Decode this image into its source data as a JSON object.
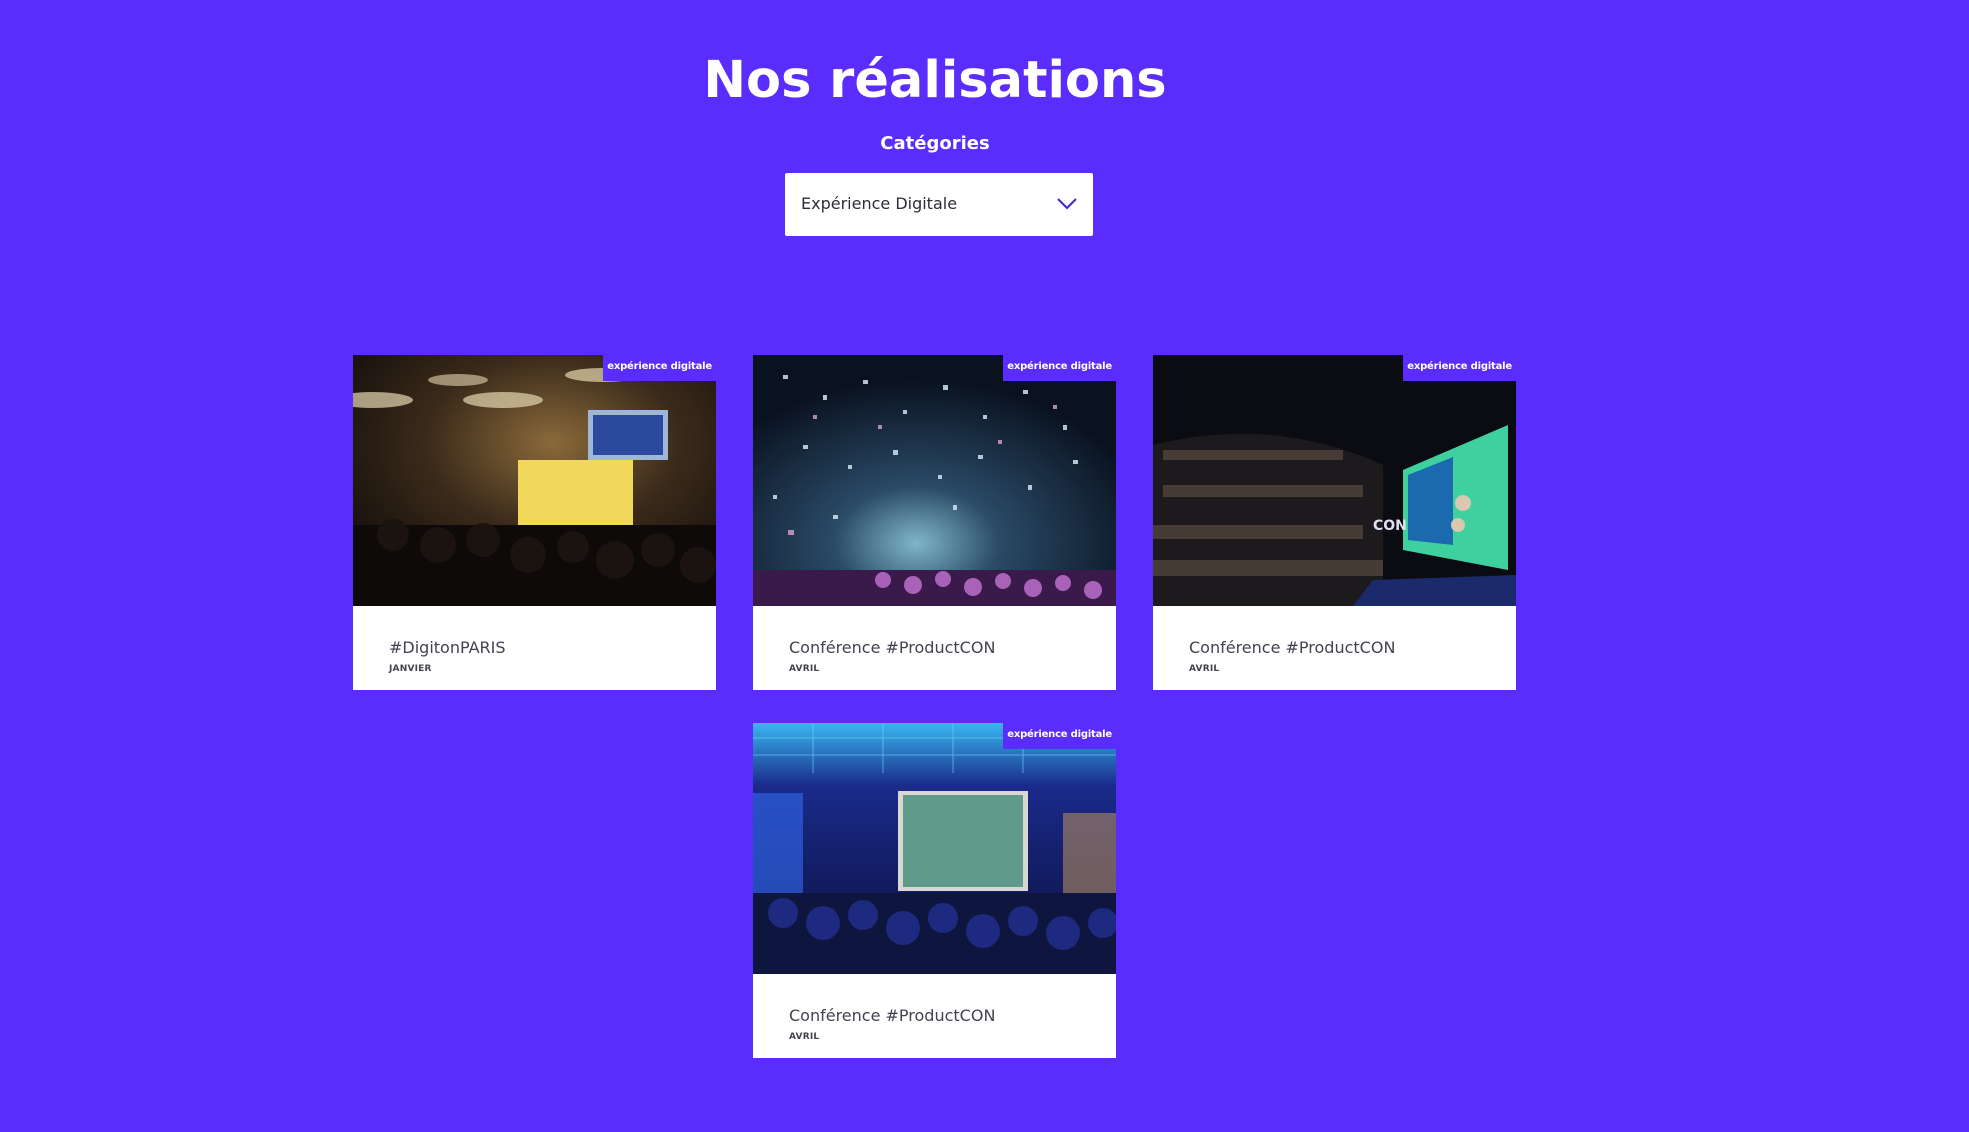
{
  "header": {
    "title": "Nos réalisations"
  },
  "filter": {
    "label": "Catégories",
    "selected": "Expérience Digitale"
  },
  "colors": {
    "background": "#5a2dfc",
    "card": "#ffffff",
    "text_dark": "#43434f"
  },
  "cards": [
    {
      "badge": "expérience digitale",
      "title": "#DigitonPARIS",
      "date": "JANVIER"
    },
    {
      "badge": "expérience digitale",
      "title": "Conférence #ProductCON",
      "date": "AVRIL"
    },
    {
      "badge": "expérience digitale",
      "title": "Conférence #ProductCON",
      "date": "AVRIL"
    },
    {
      "badge": "expérience digitale",
      "title": "Conférence #ProductCON",
      "date": "AVRIL"
    }
  ],
  "icons": {
    "select": "chevron-down-icon"
  }
}
